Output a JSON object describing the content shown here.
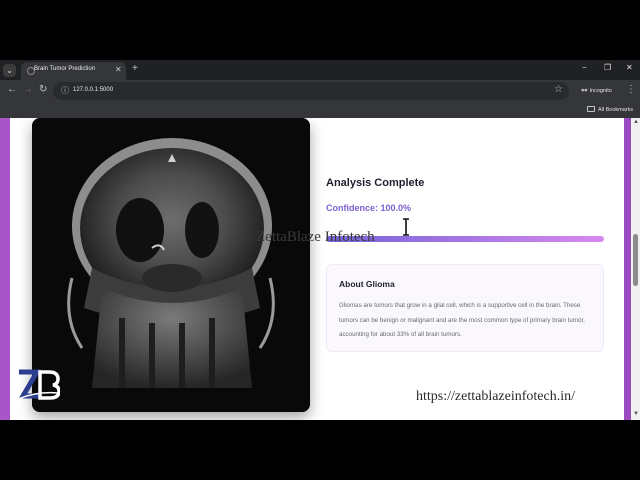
{
  "browser": {
    "tab_title": "Brain Tumor Prediction",
    "url": "127.0.0.1:5000",
    "profile_label": "Incognito",
    "bookmarks_label": "All Bookmarks",
    "icons": [
      "tab-list-icon",
      "close-icon",
      "new-tab-icon",
      "minimize-icon",
      "restore-icon",
      "back-icon",
      "forward-icon",
      "reload-icon",
      "site-info-icon",
      "bookmark-star-icon",
      "incognito-icon",
      "menu-icon",
      "folder-icon"
    ]
  },
  "result": {
    "title": "Analysis Complete",
    "confidence_label": "Confidence: 100.0%",
    "confidence_value": 1.0
  },
  "about": {
    "title": "About Glioma",
    "description": "Gliomas are tumors that grow in a glial cell, which is a supportive cell in the brain. These tumors can be benign or malignant and are the most common type of primary brain tumor, accounting for about 33% of all brain tumors."
  },
  "overlay": {
    "watermark": "ZettaBlaze Infotech",
    "website": "https://zettablazeinfotech.in/",
    "logo_text": "ZB"
  },
  "colors": {
    "accent": "#7c5fd0",
    "page_gradient": "#a855c9",
    "bar_start": "#7463d8",
    "bar_end": "#d889ee"
  }
}
